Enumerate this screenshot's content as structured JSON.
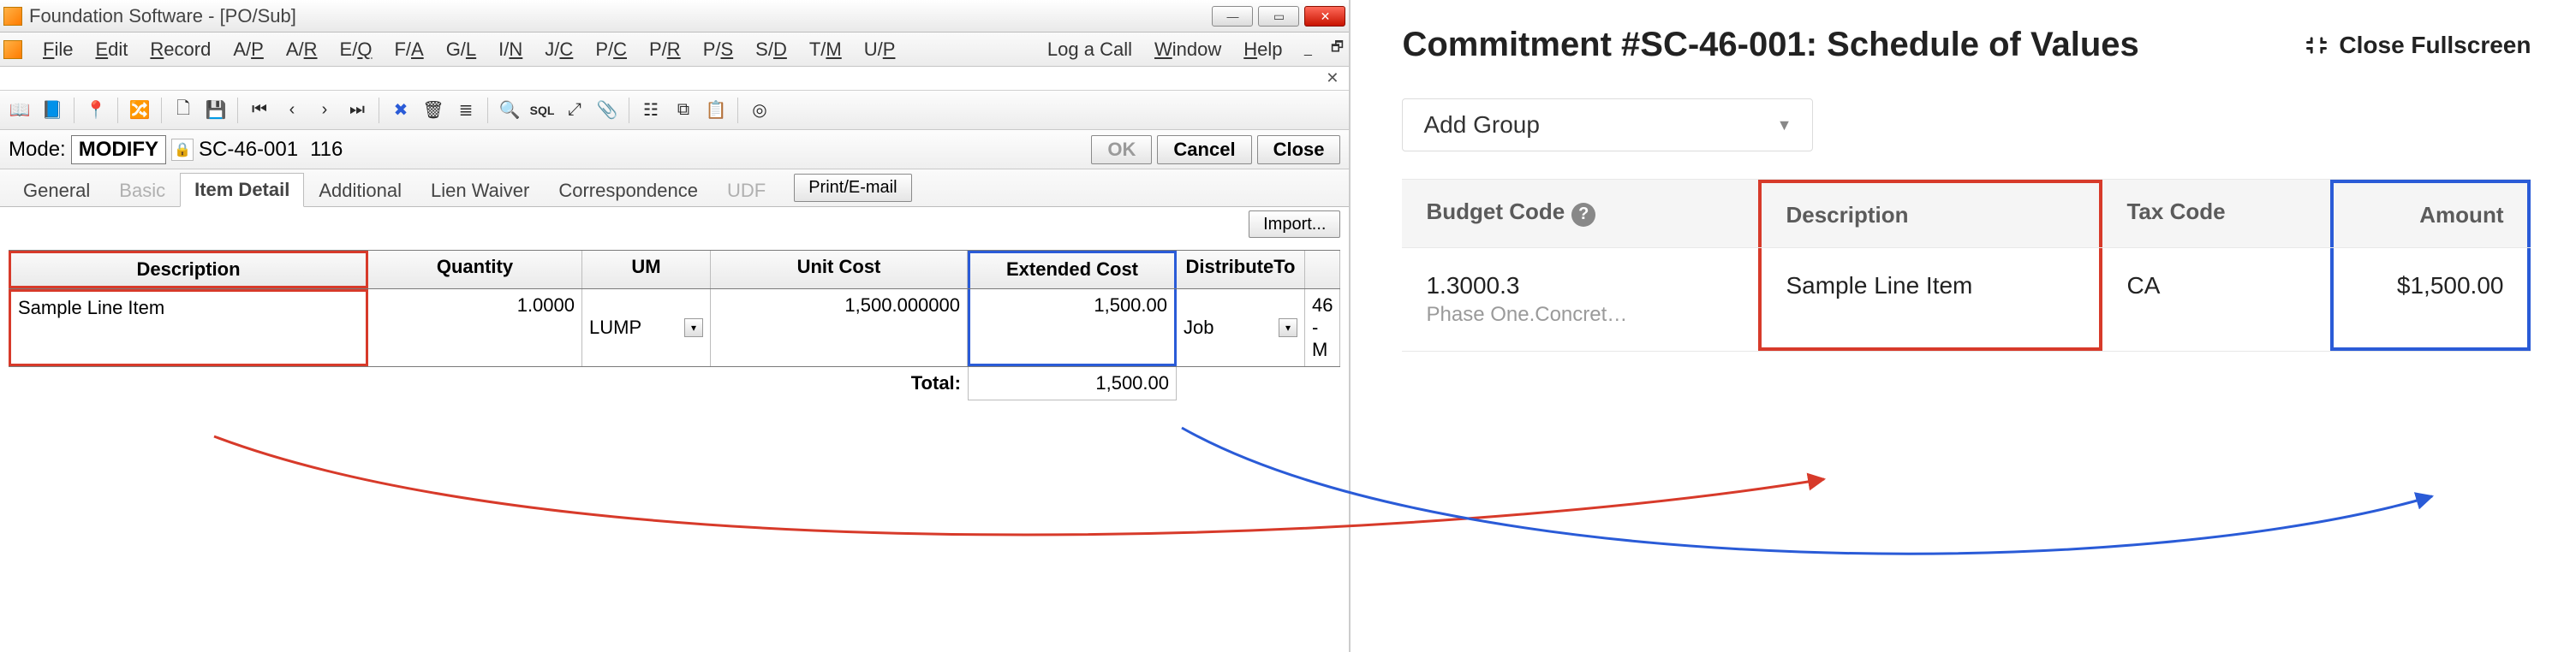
{
  "titlebar": {
    "text": "Foundation Software - [PO/Sub]"
  },
  "menubar": {
    "items": [
      "File",
      "Edit",
      "Record",
      "A/P",
      "A/R",
      "E/Q",
      "F/A",
      "G/L",
      "I/N",
      "J/C",
      "P/C",
      "P/R",
      "P/S",
      "S/D",
      "T/M",
      "U/P"
    ],
    "log_a_call": "Log a Call",
    "window": "Window",
    "help": "Help"
  },
  "mode": {
    "label": "Mode:",
    "value": "MODIFY",
    "doc_no": "SC-46-001",
    "seq": "116",
    "ok": "OK",
    "cancel": "Cancel",
    "close": "Close"
  },
  "tabs": {
    "items": [
      {
        "label": "General",
        "state": "normal"
      },
      {
        "label": "Basic",
        "state": "disabled"
      },
      {
        "label": "Item Detail",
        "state": "active"
      },
      {
        "label": "Additional",
        "state": "normal"
      },
      {
        "label": "Lien Waiver",
        "state": "normal"
      },
      {
        "label": "Correspondence",
        "state": "normal"
      },
      {
        "label": "UDF",
        "state": "disabled"
      }
    ],
    "print_email": "Print/E-mail",
    "import": "Import..."
  },
  "grid": {
    "headers": {
      "desc": "Description",
      "qty": "Quantity",
      "um": "UM",
      "uc": "Unit Cost",
      "ec": "Extended Cost",
      "dt": "DistributeTo"
    },
    "row": {
      "desc": "Sample Line Item",
      "qty": "1.0000",
      "um": "LUMP",
      "uc": "1,500.000000",
      "ec": "1,500.00",
      "dt": "Job",
      "dv": "46 - M"
    },
    "total_label": "Total:",
    "total_value": "1,500.00"
  },
  "right": {
    "title": "Commitment #SC-46-001: Schedule of Values",
    "close_fullscreen": "Close Fullscreen",
    "add_group": "Add Group",
    "headers": {
      "bc": "Budget Code",
      "desc": "Description",
      "tax": "Tax Code",
      "amt": "Amount"
    },
    "row": {
      "bc": "1.3000.3",
      "bc_sub": "Phase One.Concret…",
      "desc": "Sample Line Item",
      "tax": "CA",
      "amt": "$1,500.00"
    }
  }
}
